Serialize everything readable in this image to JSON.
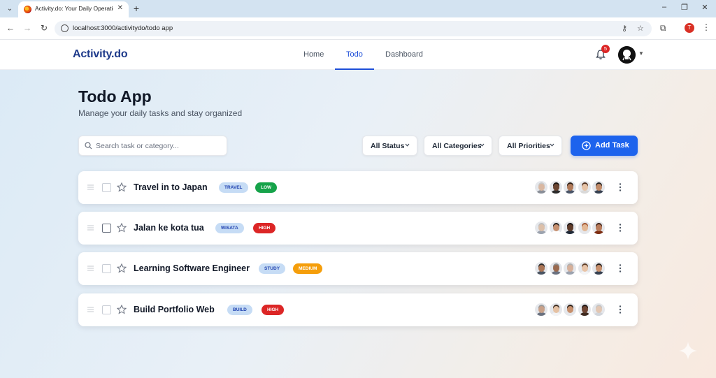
{
  "browser": {
    "tab_title": "Activity.do: Your Daily Operations",
    "url": "localhost:3000/activitydo/todo app",
    "profile_initial": "T"
  },
  "nav": {
    "logo": "Activity.do",
    "links": [
      "Home",
      "Todo",
      "Dashboard"
    ],
    "active_link": "Todo",
    "notification_count": "5"
  },
  "page": {
    "title": "Todo App",
    "subtitle": "Manage your daily tasks and stay organized"
  },
  "toolbar": {
    "search_placeholder": "Search task or category...",
    "status_filter": "All Status",
    "category_filter": "All Categories",
    "priority_filter": "All Priorities",
    "add_label": "Add Task"
  },
  "tasks": [
    {
      "title": "Travel in to Japan",
      "category": "TRAVEL",
      "priority": "LOW",
      "avatars": [
        {
          "skin": "#d9b8a2",
          "hair": "#c9c9c9",
          "shirt": "#8a8f98"
        },
        {
          "skin": "#6b4532",
          "hair": "#1b1410",
          "shirt": "#2b2b2b"
        },
        {
          "skin": "#b07a5a",
          "hair": "#2a1b12",
          "shirt": "#4a5568"
        },
        {
          "skin": "#e6c3a7",
          "hair": "#4a2d1c",
          "shirt": "#d9d9d9"
        },
        {
          "skin": "#c08a68",
          "hair": "#1f1f1f",
          "shirt": "#374151"
        }
      ]
    },
    {
      "title": "Jalan ke kota tua",
      "category": "WISATA",
      "priority": "HIGH",
      "avatars": [
        {
          "skin": "#dcc0aa",
          "hair": "#bdbdbd",
          "shirt": "#9ca3af"
        },
        {
          "skin": "#c69070",
          "hair": "#1f1a17",
          "shirt": "#ffffff"
        },
        {
          "skin": "#5e3b2a",
          "hair": "#141010",
          "shirt": "#1f2937"
        },
        {
          "skin": "#e3b895",
          "hair": "#a0522d",
          "shirt": "#e5e7eb"
        },
        {
          "skin": "#b87b5a",
          "hair": "#3b1f14",
          "shirt": "#7c2d12"
        }
      ]
    },
    {
      "title": "Learning Software Engineer",
      "category": "STUDY",
      "priority": "MEDIUM",
      "avatars": [
        {
          "skin": "#a97455",
          "hair": "#2b2b2b",
          "shirt": "#4b5563"
        },
        {
          "skin": "#9a6a4f",
          "hair": "#8d8d8d",
          "shirt": "#6b7280"
        },
        {
          "skin": "#d6b09a",
          "hair": "#b0b0b0",
          "shirt": "#9ca3af"
        },
        {
          "skin": "#e8c4a8",
          "hair": "#5a3a24",
          "shirt": "#f3f4f6"
        },
        {
          "skin": "#c78f6c",
          "hair": "#1f1a17",
          "shirt": "#374151"
        }
      ]
    },
    {
      "title": "Build Portfolio Web",
      "category": "BUILD",
      "priority": "HIGH",
      "avatars": [
        {
          "skin": "#c9a189",
          "hair": "#9a9a9a",
          "shirt": "#6b7280"
        },
        {
          "skin": "#e5c1a3",
          "hair": "#3b2a1e",
          "shirt": "#f3f4f6"
        },
        {
          "skin": "#c7906d",
          "hair": "#2a1d15",
          "shirt": "#e5e7eb"
        },
        {
          "skin": "#6d4432",
          "hair": "#1a1311",
          "shirt": "#3f2a20"
        },
        {
          "skin": "#e2c6b2",
          "hair": "#c4c4c4",
          "shirt": "#d1d5db"
        }
      ]
    }
  ],
  "colors": {
    "brand": "#1e3a8a",
    "accent": "#1d63ed",
    "chip_category_bg": "#c6dcf5",
    "priority_low": "#16a34a",
    "priority_high": "#dc2626",
    "priority_medium": "#f59e0b"
  }
}
